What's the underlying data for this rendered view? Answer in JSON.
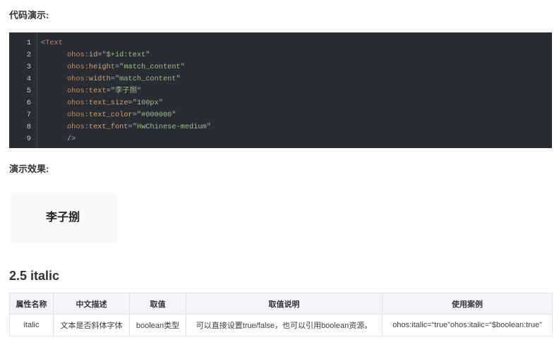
{
  "code_section": {
    "heading": "代码演示:"
  },
  "code_block": {
    "background": "#282c34",
    "token_colors": {
      "punct": "#abb2bf",
      "tag": "#e06c75",
      "ns": "#c98c5a",
      "attr": "#e3a05f",
      "string": "#98c379"
    },
    "line_numbers": [
      "1",
      "2",
      "3",
      "4",
      "5",
      "6",
      "7",
      "8",
      "9"
    ],
    "lines": [
      {
        "indent": 0,
        "tokens": [
          {
            "kind": "punct",
            "text": "<"
          },
          {
            "kind": "tag",
            "text": "Text"
          }
        ]
      },
      {
        "indent": 1,
        "tokens": [
          {
            "kind": "ns",
            "text": "ohos:"
          },
          {
            "kind": "attr",
            "text": "id"
          },
          {
            "kind": "punct",
            "text": "=\""
          },
          {
            "kind": "string",
            "text": "$+id:text"
          },
          {
            "kind": "punct",
            "text": "\""
          }
        ]
      },
      {
        "indent": 1,
        "tokens": [
          {
            "kind": "ns",
            "text": "ohos:"
          },
          {
            "kind": "attr",
            "text": "height"
          },
          {
            "kind": "punct",
            "text": "=\""
          },
          {
            "kind": "string",
            "text": "match_content"
          },
          {
            "kind": "punct",
            "text": "\""
          }
        ]
      },
      {
        "indent": 1,
        "tokens": [
          {
            "kind": "ns",
            "text": "ohos:"
          },
          {
            "kind": "attr",
            "text": "width"
          },
          {
            "kind": "punct",
            "text": "=\""
          },
          {
            "kind": "string",
            "text": "match_content"
          },
          {
            "kind": "punct",
            "text": "\""
          }
        ]
      },
      {
        "indent": 1,
        "tokens": [
          {
            "kind": "ns",
            "text": "ohos:"
          },
          {
            "kind": "attr",
            "text": "text"
          },
          {
            "kind": "punct",
            "text": "=\""
          },
          {
            "kind": "string",
            "text": "李子捌"
          },
          {
            "kind": "punct",
            "text": "\""
          }
        ]
      },
      {
        "indent": 1,
        "tokens": [
          {
            "kind": "ns",
            "text": "ohos:"
          },
          {
            "kind": "attr",
            "text": "text_size"
          },
          {
            "kind": "punct",
            "text": "=\""
          },
          {
            "kind": "string",
            "text": "100px"
          },
          {
            "kind": "punct",
            "text": "\""
          }
        ]
      },
      {
        "indent": 1,
        "tokens": [
          {
            "kind": "ns",
            "text": "ohos:"
          },
          {
            "kind": "attr",
            "text": "text_color"
          },
          {
            "kind": "punct",
            "text": "=\""
          },
          {
            "kind": "string",
            "text": "#000000"
          },
          {
            "kind": "punct",
            "text": "\""
          }
        ]
      },
      {
        "indent": 1,
        "tokens": [
          {
            "kind": "ns",
            "text": "ohos:"
          },
          {
            "kind": "attr",
            "text": "text_font"
          },
          {
            "kind": "punct",
            "text": "=\""
          },
          {
            "kind": "string",
            "text": "HwChinese-medium"
          },
          {
            "kind": "punct",
            "text": "\""
          }
        ]
      },
      {
        "indent": 1,
        "tokens": [
          {
            "kind": "punct",
            "text": "/>"
          }
        ]
      }
    ]
  },
  "demo_section": {
    "heading": "演示效果:",
    "preview_text": "李子捌"
  },
  "italic_section": {
    "title": "2.5 italic"
  },
  "attribute_table": {
    "header_bg": "#f3f5f8",
    "headers": [
      "属性名称",
      "中文描述",
      "取值",
      "取值说明",
      "使用案例"
    ],
    "rows": [
      [
        "italic",
        "文本是否斜体字体",
        "boolean类型",
        "可以直接设置true/false，也可以引用boolean资源。",
        "ohos:italic=“true”ohos:italic=“$boolean:true”"
      ]
    ]
  }
}
